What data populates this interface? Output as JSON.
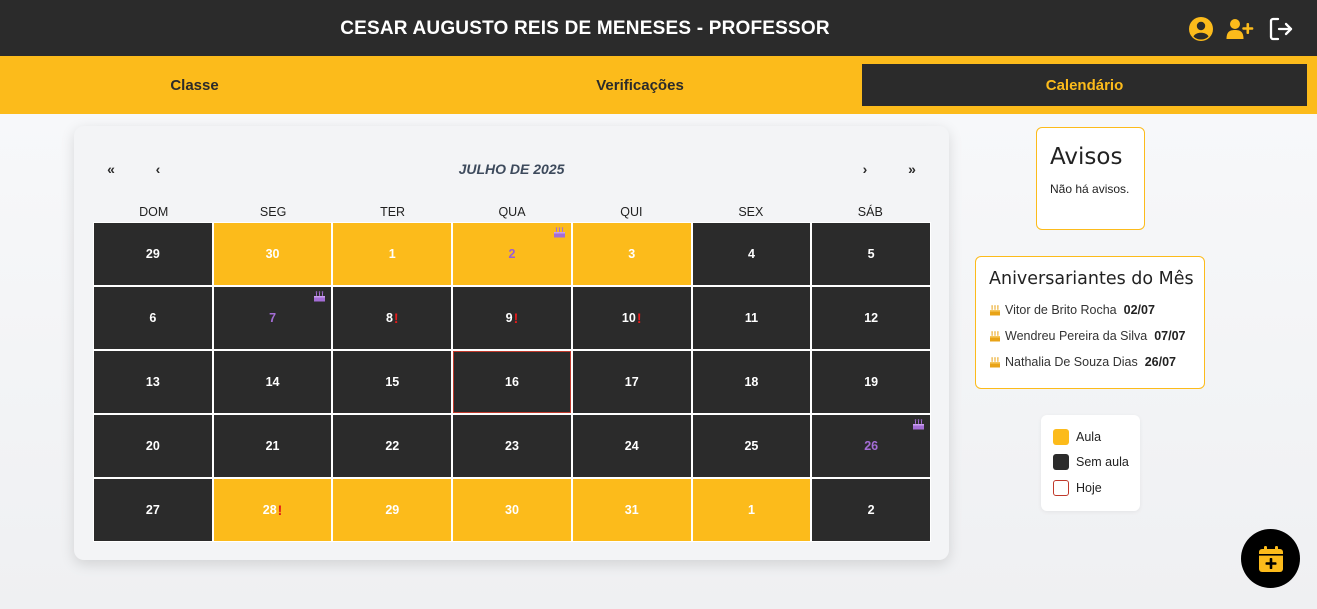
{
  "header": {
    "title": "CESAR AUGUSTO REIS DE MENESES - PROFESSOR",
    "icons": [
      "user-circle-icon",
      "user-plus-icon",
      "logout-icon"
    ],
    "accent": "#fcbb1b",
    "bg": "#2b2b2b"
  },
  "tabs": [
    {
      "label": "Classe",
      "active": false
    },
    {
      "label": "Verificações",
      "active": false
    },
    {
      "label": "Calendário",
      "active": true
    }
  ],
  "calendar": {
    "month_label": "JULHO DE 2025",
    "nav": {
      "first": "«",
      "prev": "‹",
      "next": "›",
      "last": "»"
    },
    "weekdays": [
      "DOM",
      "SEG",
      "TER",
      "QUA",
      "QUI",
      "SEX",
      "SÁB"
    ],
    "days": [
      {
        "day": "29",
        "type": "sem-aula"
      },
      {
        "day": "30",
        "type": "aula"
      },
      {
        "day": "1",
        "type": "aula"
      },
      {
        "day": "2",
        "type": "aula",
        "birthday": true
      },
      {
        "day": "3",
        "type": "aula"
      },
      {
        "day": "4",
        "type": "sem-aula"
      },
      {
        "day": "5",
        "type": "sem-aula"
      },
      {
        "day": "6",
        "type": "sem-aula"
      },
      {
        "day": "7",
        "type": "sem-aula",
        "birthday": true
      },
      {
        "day": "8",
        "type": "sem-aula",
        "alert": "!"
      },
      {
        "day": "9",
        "type": "sem-aula",
        "alert": "!"
      },
      {
        "day": "10",
        "type": "sem-aula",
        "alert": "!"
      },
      {
        "day": "11",
        "type": "sem-aula"
      },
      {
        "day": "12",
        "type": "sem-aula"
      },
      {
        "day": "13",
        "type": "sem-aula"
      },
      {
        "day": "14",
        "type": "sem-aula"
      },
      {
        "day": "15",
        "type": "sem-aula"
      },
      {
        "day": "16",
        "type": "sem-aula",
        "today": true
      },
      {
        "day": "17",
        "type": "sem-aula"
      },
      {
        "day": "18",
        "type": "sem-aula"
      },
      {
        "day": "19",
        "type": "sem-aula"
      },
      {
        "day": "20",
        "type": "sem-aula"
      },
      {
        "day": "21",
        "type": "sem-aula"
      },
      {
        "day": "22",
        "type": "sem-aula"
      },
      {
        "day": "23",
        "type": "sem-aula"
      },
      {
        "day": "24",
        "type": "sem-aula"
      },
      {
        "day": "25",
        "type": "sem-aula"
      },
      {
        "day": "26",
        "type": "sem-aula",
        "birthday": true
      },
      {
        "day": "27",
        "type": "sem-aula"
      },
      {
        "day": "28",
        "type": "aula",
        "alert": "!"
      },
      {
        "day": "29",
        "type": "aula"
      },
      {
        "day": "30",
        "type": "aula"
      },
      {
        "day": "31",
        "type": "aula"
      },
      {
        "day": "1",
        "type": "aula"
      },
      {
        "day": "2",
        "type": "sem-aula"
      }
    ]
  },
  "avisos": {
    "title": "Avisos",
    "empty_text": "Não há avisos."
  },
  "aniversariantes": {
    "title": "Aniversariantes do Mês",
    "items": [
      {
        "name": "Vitor de Brito Rocha",
        "date": "02/07"
      },
      {
        "name": "Wendreu Pereira da Silva",
        "date": "07/07"
      },
      {
        "name": "Nathalia De Souza Dias",
        "date": "26/07"
      }
    ]
  },
  "legend": [
    {
      "label": "Aula",
      "color": "#fcbb1b"
    },
    {
      "label": "Sem aula",
      "color": "#2b2b2b"
    },
    {
      "label": "Hoje",
      "color": "#c0392b"
    }
  ],
  "fab": {
    "icon": "calendar-plus-icon"
  }
}
